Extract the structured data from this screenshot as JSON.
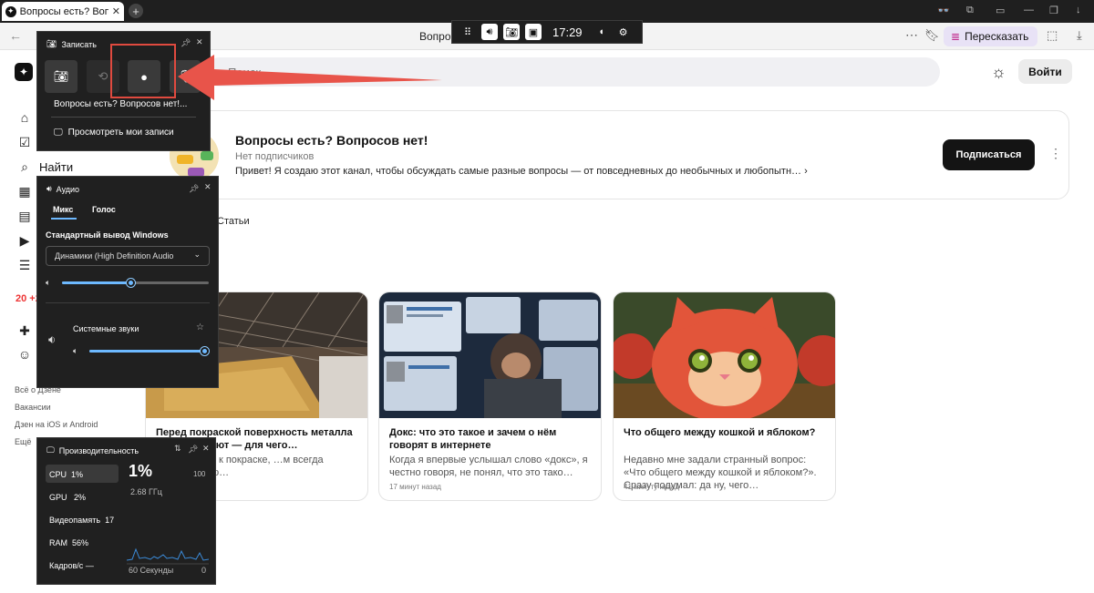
{
  "browser": {
    "tab_title": "Вопросы есть? Вопросов нет!",
    "page_title": "Вопро",
    "retell_label": "Пересказать"
  },
  "gamebar": {
    "time": "17:29"
  },
  "sidebar": {
    "search_label": "Найти",
    "badge_number": "20 +25",
    "footer_links": [
      "Всё о Дзене",
      "Вакансии",
      "Дзен на iOS и Android",
      "Ещё"
    ]
  },
  "header": {
    "search_placeholder": "Поиск",
    "login_label": "Войти"
  },
  "channel": {
    "name": "Вопросы есть? Вопросов нет!",
    "subscribers": "Нет подписчиков",
    "description": "Привет! Я создаю этот канал, чтобы обсуждать самые разные вопросы — от повседневных до необычных и любопытн…",
    "subscribe_label": "Подписаться",
    "tab_articles": "Статьи"
  },
  "articles": [
    {
      "title": "Перед покраской поверхность металла обезжиривают — для чего…",
      "desc": "…лю металл к покраске, …м всегда обезжириваю…",
      "time": ""
    },
    {
      "title": "Докс: что это такое и зачем о нём говорят в интернете",
      "desc": "Когда я впервые услышал слово «докс», я честно говоря, не понял, что это тако…",
      "time": "17 минут назад"
    },
    {
      "title": "Что общего между кошкой и яблоком?",
      "desc": "Недавно мне задали странный вопрос: «Что общего между кошкой и яблоком?». Сразу подумал: да ну, чего…",
      "time": "41 минуту назад"
    }
  ],
  "capture_panel": {
    "title": "Записать",
    "recording_title": "Вопросы есть? Вопросов нет!...",
    "view_recordings": "Просмотреть мои записи"
  },
  "audio_panel": {
    "title": "Аудио",
    "tab_mix": "Микс",
    "tab_voice": "Голос",
    "output_label": "Стандартный вывод Windows",
    "device": "Динамики (High Definition Audio",
    "master_volume": 0.48,
    "system_sounds_label": "Системные звуки",
    "system_volume": 1.0
  },
  "perf_panel": {
    "title": "Производительность",
    "cpu_label": "CPU",
    "cpu_value": "1%",
    "gpu_label": "GPU",
    "gpu_value": "2%",
    "vram_label": "Видеопамять",
    "vram_value": "17",
    "ram_label": "RAM",
    "ram_value": "56%",
    "fps_label": "Кадров/с",
    "fps_value": "—",
    "big_value": "1%",
    "freq": "2.68 ГГц",
    "max_value": "100",
    "axis_left": "60 Секунды",
    "axis_right": "0"
  }
}
